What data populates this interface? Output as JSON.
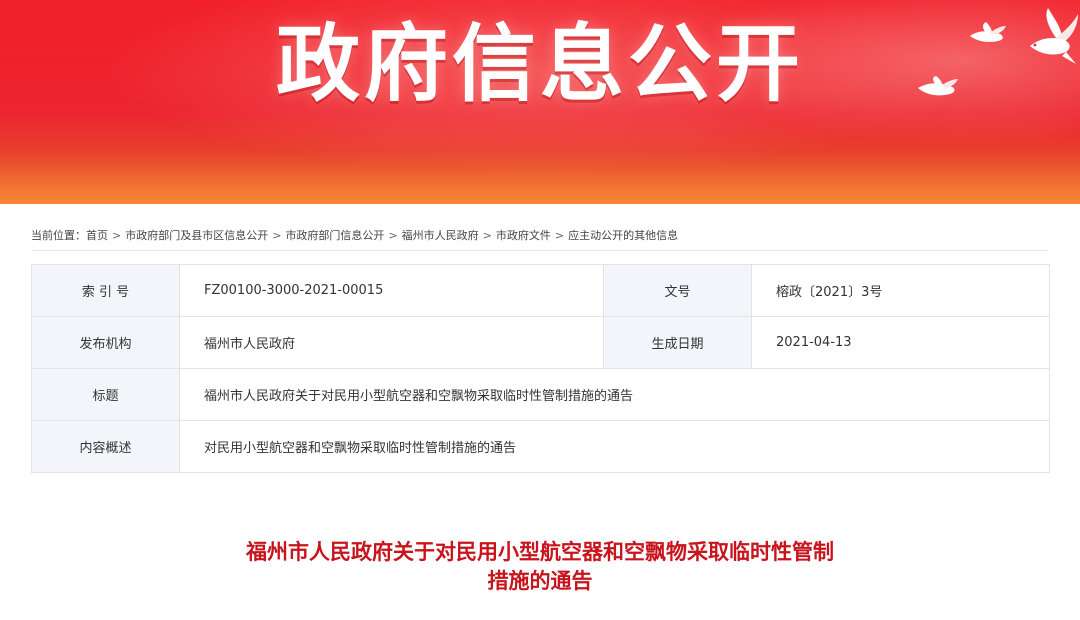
{
  "banner": {
    "title": "政府信息公开"
  },
  "breadcrumb": {
    "prefix": "当前位置：",
    "items": [
      "首页",
      "市政府部门及县市区信息公开",
      "市政府部门信息公开",
      "福州市人民政府",
      "市政府文件",
      "应主动公开的其他信息"
    ],
    "separator": ">"
  },
  "info": {
    "index_label": "索 引 号",
    "index_value": "FZ00100-3000-2021-00015",
    "docno_label": "文号",
    "docno_value": "榕政〔2021〕3号",
    "publisher_label": "发布机构",
    "publisher_value": "福州市人民政府",
    "date_label": "生成日期",
    "date_value": "2021-04-13",
    "title_label": "标题",
    "title_value": "福州市人民政府关于对民用小型航空器和空飘物采取临时性管制措施的通告",
    "summary_label": "内容概述",
    "summary_value": "对民用小型航空器和空飘物采取临时性管制措施的通告"
  },
  "document": {
    "title_line1": "福州市人民政府关于对民用小型航空器和空飘物采取临时性管制",
    "title_line2": "措施的通告"
  },
  "colors": {
    "banner_red": "#ee2230",
    "banner_orange": "#f0732f",
    "title_red": "#c8141c",
    "label_bg": "#f4f5fa"
  }
}
